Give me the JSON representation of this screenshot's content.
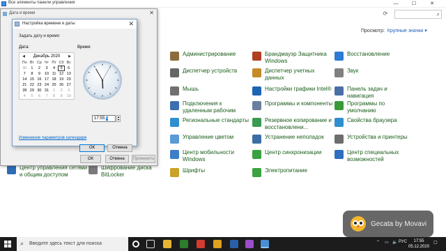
{
  "control_panel": {
    "window_title": "Все элементы панели управления",
    "view_label": "Просмотр:",
    "view_value": "Крупные значки ▾",
    "items": [
      {
        "label": "Администрирование",
        "icon": "admin-tools-icon",
        "color": "#8a6d3b"
      },
      {
        "label": "Брандмауэр Защитника Windows",
        "icon": "firewall-icon",
        "color": "#b04020"
      },
      {
        "label": "Восстановление",
        "icon": "recovery-icon",
        "color": "#2d7bd2"
      },
      {
        "label": "Диспетчер устройств",
        "icon": "device-manager-icon",
        "color": "#666666"
      },
      {
        "label": "Диспетчер учетных данных",
        "icon": "credential-manager-icon",
        "color": "#c58a2a"
      },
      {
        "label": "Звук",
        "icon": "sound-icon",
        "color": "#808080"
      },
      {
        "label": "Мышь",
        "icon": "mouse-icon",
        "color": "#707070"
      },
      {
        "label": "Настройки графики Intel®",
        "icon": "intel-graphics-icon",
        "color": "#1e64b4"
      },
      {
        "label": "Панель задач и навигация",
        "icon": "taskbar-icon",
        "color": "#4a6fa5"
      },
      {
        "label": "Подключения к удаленным рабочим",
        "icon": "remote-desktop-icon",
        "color": "#3c6fb0"
      },
      {
        "label": "Программы и компоненты",
        "icon": "programs-icon",
        "color": "#6a7fa0"
      },
      {
        "label": "Программы по умолчанию",
        "icon": "default-programs-icon",
        "color": "#3a9a3a"
      },
      {
        "label": "Региональные стандарты",
        "icon": "region-icon",
        "color": "#2f8fd0"
      },
      {
        "label": "Резервное копирование и восстановлени...",
        "icon": "backup-icon",
        "color": "#3a9a50"
      },
      {
        "label": "Свойства браузера",
        "icon": "internet-options-icon",
        "color": "#2f8fd0"
      },
      {
        "label": "Управление цветом",
        "icon": "color-management-icon",
        "color": "#5a9ad6"
      },
      {
        "label": "Устранение неполадок",
        "icon": "troubleshooting-icon",
        "color": "#3b6ea5"
      },
      {
        "label": "Устройства и принтеры",
        "icon": "printer-icon",
        "color": "#6d6d6d"
      },
      {
        "label": "Центр мобильности Windows",
        "icon": "mobility-center-icon",
        "color": "#3f7ec8"
      },
      {
        "label": "Центр синхронизации",
        "icon": "sync-center-icon",
        "color": "#3aa340"
      },
      {
        "label": "Центр специальных возможностей",
        "icon": "ease-of-access-icon",
        "color": "#2f6fc0"
      },
      {
        "label": "Центр управления сетями и общим доступом",
        "icon": "network-center-icon",
        "color": "#2e6db4"
      },
      {
        "label": "Шифрование диска BitLocker",
        "icon": "bitlocker-icon",
        "color": "#7a7a7a"
      },
      {
        "label": "Шрифты",
        "icon": "fonts-icon",
        "color": "#c9a227"
      },
      {
        "label": "Электропитание",
        "icon": "power-options-icon",
        "color": "#3aa340"
      }
    ]
  },
  "datetime_dialog": {
    "title": "Дата и время",
    "buttons": {
      "ok": "ОК",
      "cancel": "Отмена",
      "apply": "Применить"
    }
  },
  "time_settings": {
    "title": "Настройка времени и даты",
    "heading": "Задать дату и время:",
    "date_label": "Дата:",
    "time_label": "Время:",
    "month": "Декабрь 2020",
    "prev": "◀",
    "next": "▶",
    "weekdays": [
      "Пн",
      "Вт",
      "Ср",
      "Чт",
      "Пт",
      "Сб",
      "Вс"
    ],
    "days": [
      "30",
      "1",
      "2",
      "3",
      "4",
      "5",
      "6",
      "7",
      "8",
      "9",
      "10",
      "11",
      "12",
      "13",
      "14",
      "15",
      "16",
      "17",
      "18",
      "19",
      "20",
      "21",
      "22",
      "23",
      "24",
      "25",
      "26",
      "27",
      "28",
      "29",
      "30",
      "31",
      "1",
      "2",
      "3",
      "4",
      "5",
      "6",
      "7",
      "8",
      "9",
      "10"
    ],
    "selected_day_index": 5,
    "time_hour": "17",
    "time_minute": "55",
    "time_second": "5",
    "clock_hour": 17,
    "clock_minute": 55,
    "clock_second": 5,
    "link": "Изменение параметров календаря",
    "ok": "ОК",
    "cancel": "Отмена"
  },
  "watermark": {
    "text": "Gecata by Movavi"
  },
  "taskbar": {
    "search_placeholder": "Введите здесь текст для поиска",
    "language": "РУС",
    "time": "17:55",
    "date": "05.12.2020"
  }
}
